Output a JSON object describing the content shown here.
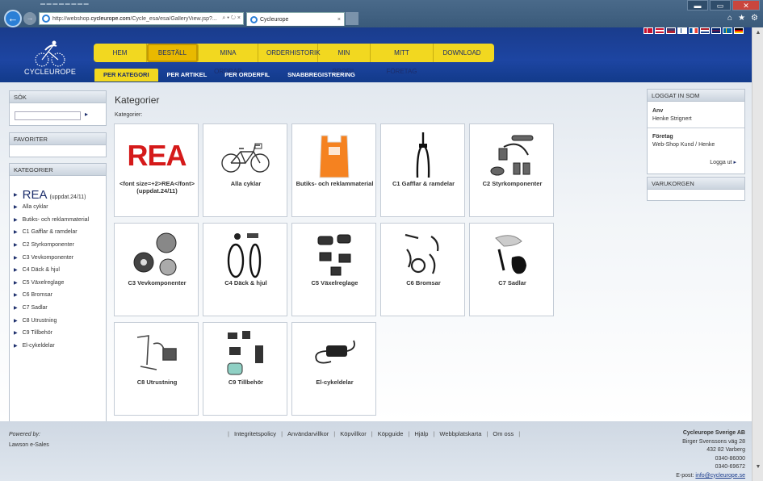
{
  "browser": {
    "back_icon": "back-arrow-icon",
    "address_host_prefix": "http://webshop.",
    "address_host_bold": "cycleurope.com",
    "address_path": "/Cycle_esa/esa/GalleryView.jsp?...",
    "address_controls": "⌕ ▾ ↻ ×",
    "tab_title": "Cycleurope",
    "tab_close": "×",
    "window_min": "▬",
    "window_max": "▭",
    "window_close": "✕",
    "tool_home": "⌂",
    "tool_star": "★",
    "tool_gear": "⚙"
  },
  "site": {
    "logo_text": "CYCLEUROPE",
    "main_nav": [
      {
        "label": "HEM",
        "active": false
      },
      {
        "label": "BESTÄLL",
        "active": true
      },
      {
        "label": "MINA ORDRAR",
        "active": false
      },
      {
        "label": "ORDERHISTORIK",
        "active": false
      },
      {
        "label": "MIN PROFIL",
        "active": false
      },
      {
        "label": "MITT FÖRETAG",
        "active": false
      },
      {
        "label": "DOWNLOAD",
        "active": false
      }
    ],
    "sub_nav": [
      {
        "label": "PER KATEGORI",
        "active": true
      },
      {
        "label": "PER ARTIKEL",
        "active": false
      },
      {
        "label": "PER ORDERFIL",
        "active": false
      },
      {
        "label": "SNABBREGISTRERING",
        "active": false
      }
    ],
    "flag_colors": [
      "#d00c33",
      "#c8102e",
      "#3c3b6e",
      "#003580",
      "#0055a4",
      "#21468b",
      "#ce1126",
      "#006aa7",
      "#000000"
    ]
  },
  "sidebar": {
    "search_header": "SÖK",
    "search_value": "",
    "search_go": "▸",
    "favorites_header": "FAVORITER",
    "categories_header": "KATEGORIER",
    "rea_big": "REA",
    "rea_small": "(uppdat.24/11)",
    "items": [
      "Alla cyklar",
      "Butiks- och reklammaterial",
      "C1 Gafflar & ramdelar",
      "C2 Styrkomponenter",
      "C3 Vevkomponenter",
      "C4 Däck & hjul",
      "C5 Växelreglage",
      "C6 Bromsar",
      "C7 Sadlar",
      "C8 Utrustning",
      "C9 Tillbehör",
      "El-cykeldelar"
    ]
  },
  "main": {
    "title": "Kategorier",
    "label": "Kategorier:",
    "rea_image_text": "REA",
    "tiles": [
      {
        "caption": "<font size=+2>REA</font> (uppdat.24/11)",
        "icon": "rea-text-image"
      },
      {
        "caption": "Alla cyklar",
        "icon": "bicycle-icon"
      },
      {
        "caption": "Butiks- och reklammaterial",
        "icon": "shopping-bag-icon"
      },
      {
        "caption": "C1 Gafflar & ramdelar",
        "icon": "fork-icon"
      },
      {
        "caption": "C2 Styrkomponenter",
        "icon": "handlebar-parts-icon"
      },
      {
        "caption": "C3 Vevkomponenter",
        "icon": "crank-parts-icon"
      },
      {
        "caption": "C4 Däck & hjul",
        "icon": "tire-wheel-icon"
      },
      {
        "caption": "C5 Växelreglage",
        "icon": "shifter-icon"
      },
      {
        "caption": "C6 Bromsar",
        "icon": "brakes-icon"
      },
      {
        "caption": "C7 Sadlar",
        "icon": "saddle-icon"
      },
      {
        "caption": "C8 Utrustning",
        "icon": "equipment-icon"
      },
      {
        "caption": "C9 Tillbehör",
        "icon": "accessories-icon"
      },
      {
        "caption": "El-cykeldelar",
        "icon": "e-bike-charger-icon"
      }
    ]
  },
  "right": {
    "login_header": "LOGGAT IN SOM",
    "anv_label": "Anv",
    "anv_value": "Henke Strignert",
    "company_label": "Företag",
    "company_value": "Web-Shop Kund / Henke",
    "logout": "Logga ut",
    "logout_arrow": "▸",
    "cart_header": "VARUKORGEN"
  },
  "footer": {
    "powered_by": "Powered by:",
    "powered_name": "Lawson e-Sales",
    "links": [
      "Integritetspolicy",
      "Användarvillkor",
      "Köpvillkor",
      "Köpguide",
      "Hjälp",
      "Webbplatskarta",
      "Om oss"
    ],
    "company_name": "Cycleurope Sverige AB",
    "address1": "Birger Svenssons väg 28",
    "address2": "432 82 Varberg",
    "phone": "0340-86000",
    "fax": "0340-69672",
    "email_label": "E-post:",
    "email": "info@cycleurope.se"
  }
}
